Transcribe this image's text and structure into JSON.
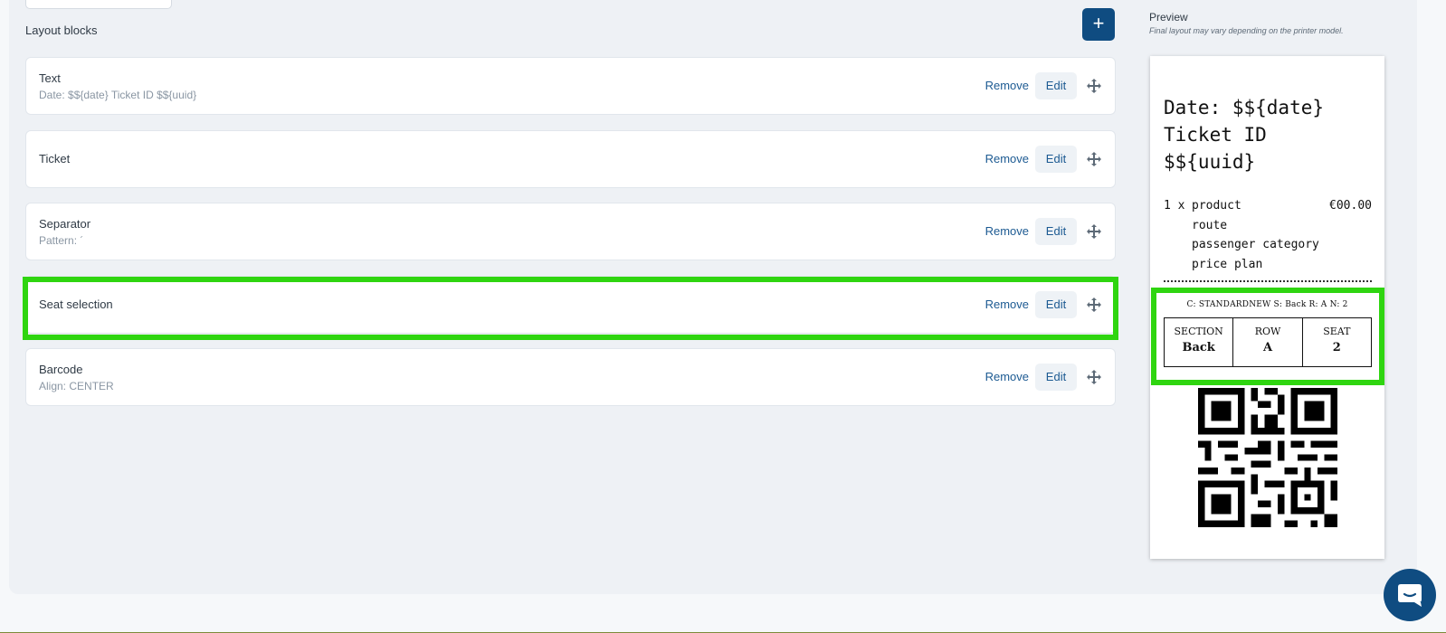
{
  "layout_blocks": {
    "title": "Layout blocks",
    "add_icon": "plus-icon",
    "items": [
      {
        "title": "Text",
        "subtitle": "Date: $${date} Ticket ID $${uuid}",
        "remove_label": "Remove",
        "edit_label": "Edit"
      },
      {
        "title": "Ticket",
        "subtitle": "",
        "remove_label": "Remove",
        "edit_label": "Edit"
      },
      {
        "title": "Separator",
        "subtitle": "Pattern: ´",
        "remove_label": "Remove",
        "edit_label": "Edit"
      },
      {
        "title": "Seat selection",
        "subtitle": "",
        "remove_label": "Remove",
        "edit_label": "Edit"
      },
      {
        "title": "Barcode",
        "subtitle": "Align: CENTER",
        "remove_label": "Remove",
        "edit_label": "Edit"
      }
    ]
  },
  "preview": {
    "title": "Preview",
    "note": "Final layout may vary depending on the printer model.",
    "receipt": {
      "line1": "Date: $${date}",
      "line2": "Ticket ID",
      "line3": "$${uuid}",
      "qty": "1 x",
      "product": "product",
      "price": "€00.00",
      "route": "route",
      "passenger_category": "passenger category",
      "price_plan": "price plan",
      "seat_caption": "C: STANDARDNEW S: Back R: A N: 2",
      "seat_table": [
        {
          "label": "SECTION",
          "value": "Back"
        },
        {
          "label": "ROW",
          "value": "A"
        },
        {
          "label": "SEAT",
          "value": "2"
        }
      ]
    }
  },
  "highlight_color": "#2fd510",
  "accent_color": "#0f4c81",
  "chat_icon": "chat-bubble-icon"
}
